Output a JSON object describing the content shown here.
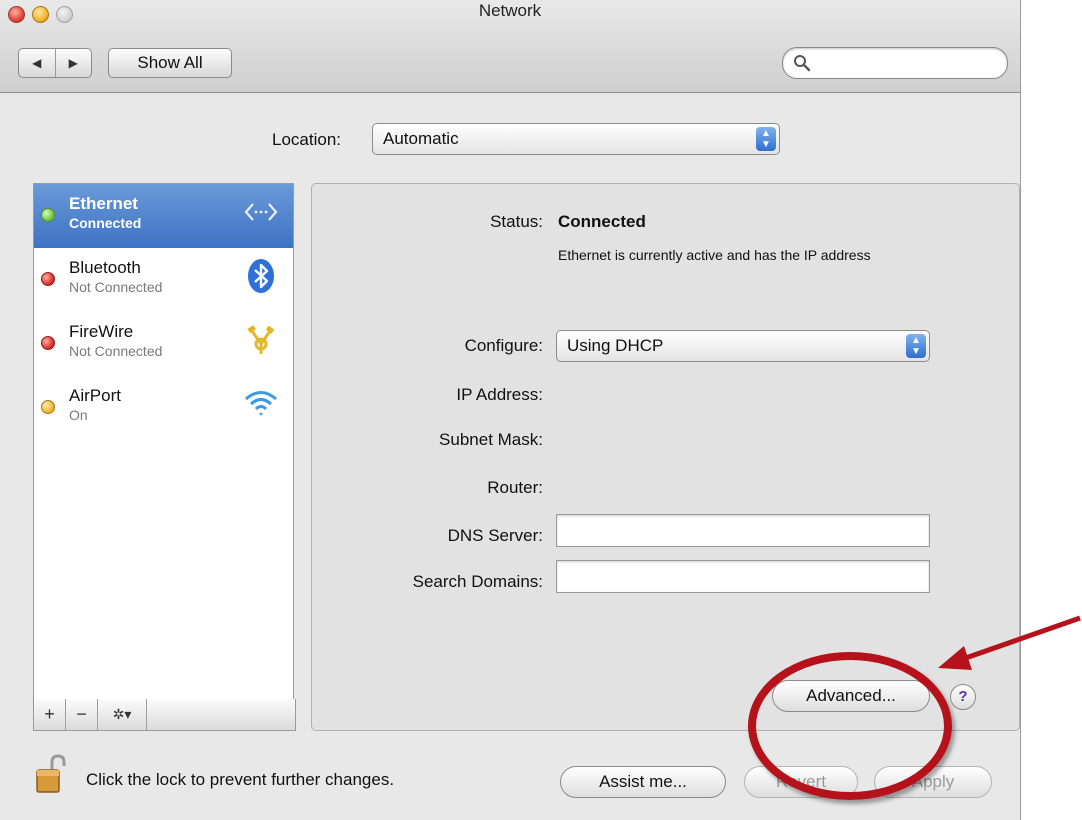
{
  "window": {
    "title": "Network"
  },
  "toolbar": {
    "show_all_label": "Show All",
    "back_glyph": "◀",
    "forward_glyph": "▶"
  },
  "location": {
    "label": "Location:",
    "value": "Automatic"
  },
  "services": [
    {
      "name": "Ethernet",
      "state": "Connected",
      "status_color": "#7fd14e",
      "icon": "ethernet-arrows-icon",
      "selected": true
    },
    {
      "name": "Bluetooth",
      "state": "Not Connected",
      "status_color": "#d9302a",
      "icon": "bluetooth-icon"
    },
    {
      "name": "FireWire",
      "state": "Not Connected",
      "status_color": "#d9302a",
      "icon": "firewire-icon"
    },
    {
      "name": "AirPort",
      "state": "On",
      "status_color": "#f0b43a",
      "icon": "wifi-icon"
    }
  ],
  "sidebar_buttons": {
    "add": "+",
    "remove": "−",
    "action": "✲▾"
  },
  "details": {
    "status_label": "Status:",
    "status_value": "Connected",
    "status_desc": "Ethernet is currently active and has the IP address",
    "configure_label": "Configure:",
    "configure_value": "Using DHCP",
    "ip_label": "IP Address:",
    "subnet_label": "Subnet Mask:",
    "router_label": "Router:",
    "dns_label": "DNS Server:",
    "search_domains_label": "Search Domains:",
    "advanced_label": "Advanced...",
    "help_label": "?"
  },
  "footer": {
    "lock_text": "Click the lock to prevent further changes.",
    "assist_label": "Assist me...",
    "revert_label": "Revert",
    "apply_label": "Apply"
  },
  "annotation": {
    "color": "#b5121b"
  }
}
